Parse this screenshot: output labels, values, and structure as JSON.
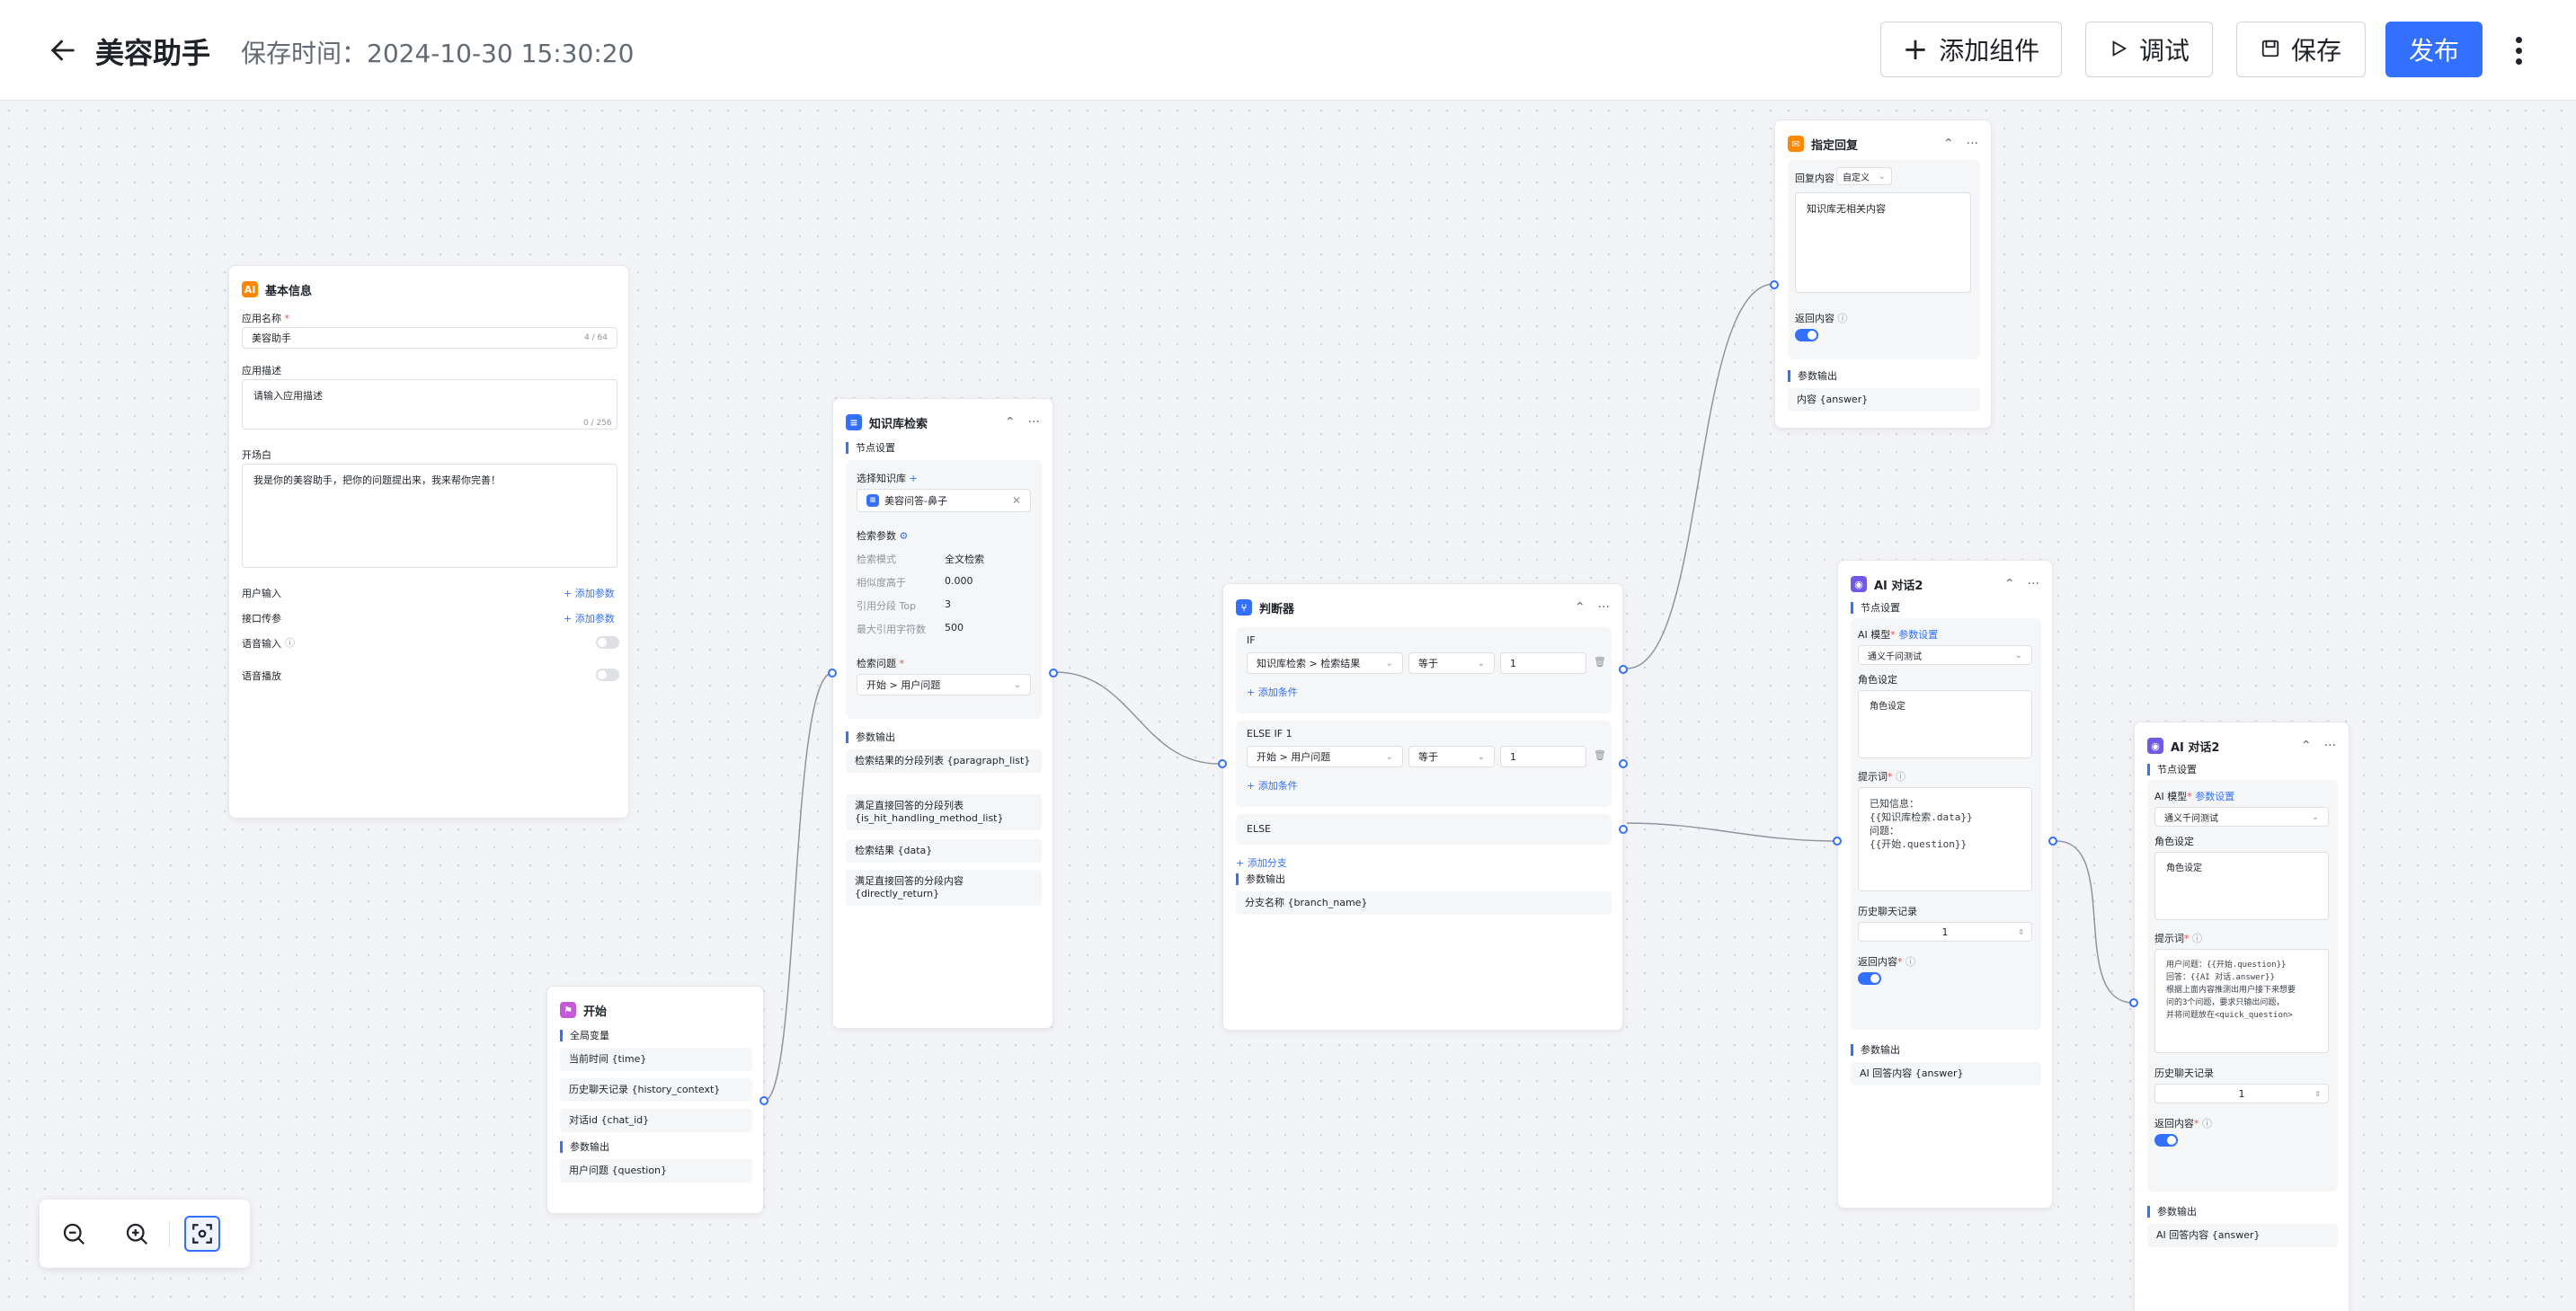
{
  "header": {
    "title": "美容助手",
    "save_time": "保存时间：2024-10-30 15:30:20",
    "add_component": "添加组件",
    "debug": "调试",
    "save": "保存",
    "publish": "发布"
  },
  "colors": {
    "accent": "#3370ff",
    "danger": "#f54a45",
    "canvas": "#f3f4f7"
  },
  "basic_info": {
    "title": "基本信息",
    "app_name_label": "应用名称",
    "app_name_value": "美容助手",
    "app_name_count": "4 / 64",
    "desc_label": "应用描述",
    "desc_placeholder": "请输入应用描述",
    "desc_count": "0 / 256",
    "opening_label": "开场白",
    "opening_value": "我是你的美容助手，把你的问题提出来，我来帮你完善！",
    "user_input_label": "用户输入",
    "user_input_add": "+ 添加参数",
    "api_param_label": "接口传参",
    "api_param_add": "+ 添加参数",
    "voice_input_label": "语音输入",
    "voice_play_label": "语音播放"
  },
  "start_node": {
    "title": "开始",
    "global_vars_label": "全局变量",
    "vars": [
      "当前时间 {time}",
      "历史聊天记录 {history_context}",
      "对话id {chat_id}"
    ],
    "output_label": "参数输出",
    "outputs": [
      "用户问题 {question}"
    ]
  },
  "kb_node": {
    "title": "知识库检索",
    "settings_label": "节点设置",
    "select_kb_label": "选择知识库",
    "selected_kb": "美容问答-鼻子",
    "search_params_label": "检索参数",
    "params": [
      {
        "k": "检索模式",
        "v": "全文检索"
      },
      {
        "k": "相似度高于",
        "v": "0.000"
      },
      {
        "k": "引用分段 Top",
        "v": "3"
      },
      {
        "k": "最大引用字符数",
        "v": "500"
      }
    ],
    "question_label": "检索问题",
    "question_value": "开始 > 用户问题",
    "output_label": "参数输出",
    "outputs": [
      "检索结果的分段列表 {paragraph_list}",
      "满足直接回答的分段列表 {is_hit_handling_method_list}",
      "检索结果 {data}",
      "满足直接回答的分段内容 {directly_return}"
    ]
  },
  "judge_node": {
    "title": "判断器",
    "if_label": "IF",
    "if_field": "知识库检索 > 检索结果",
    "if_op": "等于",
    "if_value": "1",
    "add_condition": "+ 添加条件",
    "elseif_label": "ELSE IF 1",
    "elseif_field": "开始 > 用户问题",
    "elseif_op": "等于",
    "elseif_value": "1",
    "add_condition2": "+ 添加条件",
    "else_label": "ELSE",
    "add_branch": "+ 添加分支",
    "output_label": "参数输出",
    "outputs": [
      "分支名称 {branch_name}"
    ]
  },
  "reply_node": {
    "title": "指定回复",
    "content_label": "回复内容",
    "content_mode": "自定义",
    "content_value": "知识库无相关内容",
    "return_label": "返回内容",
    "output_label": "参数输出",
    "outputs": [
      "内容 {answer}"
    ]
  },
  "ai1_node": {
    "title": "AI 对话2",
    "settings_label": "节点设置",
    "model_label": "AI 模型",
    "model_settings": "参数设置",
    "model_value": "通义千问测试",
    "role_label": "角色设定",
    "role_placeholder": "角色设定",
    "prompt_label": "提示词",
    "prompt_lines": [
      "已知信息：",
      "{{知识库检索.data}}",
      "问题：",
      "{{开始.question}}"
    ],
    "history_label": "历史聊天记录",
    "history_value": "1",
    "return_label": "返回内容",
    "output_label": "参数输出",
    "outputs": [
      "AI 回答内容 {answer}"
    ]
  },
  "ai2_node": {
    "title": "AI 对话2",
    "settings_label": "节点设置",
    "model_label": "AI 模型",
    "model_settings": "参数设置",
    "model_value": "通义千问测试",
    "role_label": "角色设定",
    "role_placeholder": "角色设定",
    "prompt_label": "提示词",
    "prompt_lines": [
      "用户问题：{{开始.question}}",
      "回答：{{AI 对话.answer}}",
      "根据上面内容推测出用户接下来想要",
      "问的3个问题，要求只输出问题，",
      "并将问题放在<quick_question>"
    ],
    "history_label": "历史聊天记录",
    "history_value": "1",
    "return_label": "返回内容",
    "output_label": "参数输出",
    "outputs": [
      "AI 回答内容 {answer}"
    ]
  }
}
